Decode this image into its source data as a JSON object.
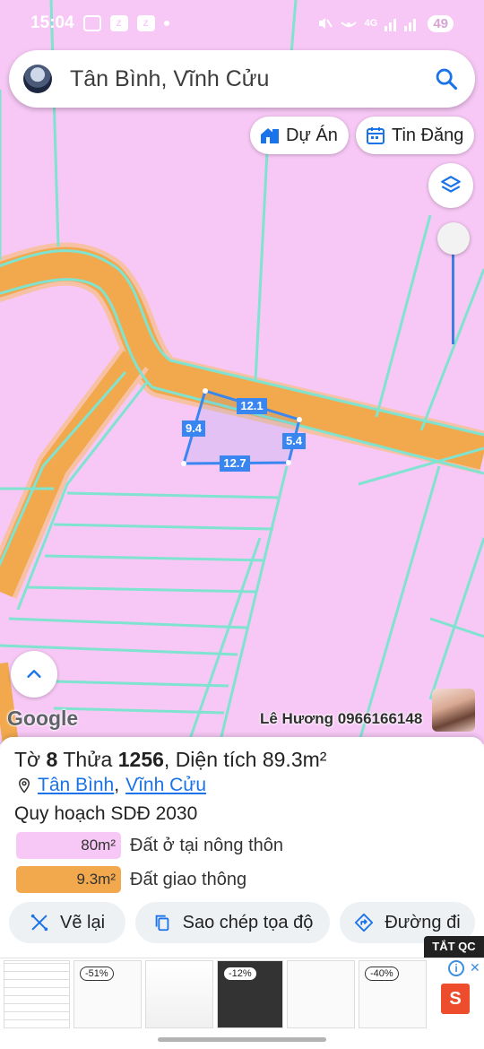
{
  "status_bar": {
    "time": "15:04",
    "battery": "49",
    "network": "4G"
  },
  "search": {
    "text": "Tân Bình, Vĩnh Cửu"
  },
  "chips": {
    "du_an": "Dự Án",
    "tin_dang": "Tin Đăng"
  },
  "map": {
    "dimensions": {
      "top": "12.1",
      "left": "9.4",
      "right": "5.4",
      "bottom": "12.7"
    },
    "google_logo": "Google",
    "contact": "Lê Hương 0966166148",
    "colors": {
      "residential": "#f7c8f5",
      "road": "#f2a84d",
      "boundary": "#7fe3d0",
      "parcel": "#3a86f0"
    }
  },
  "info": {
    "to_label": "Tờ",
    "to": "8",
    "thua_label": "Thửa",
    "thua": "1256",
    "dien_tich_label": "Diện tích",
    "area": "89.3m²",
    "location": {
      "ward": "Tân Bình",
      "separator": ",",
      "district": "Vĩnh Cửu"
    },
    "plan_title": "Quy hoạch SDĐ 2030",
    "legend": [
      {
        "value": "80m²",
        "label": "Đất ở tại nông thôn",
        "color": "#f7c8f5"
      },
      {
        "value": "9.3m²",
        "label": "Đất giao thông",
        "color": "#f2a84d"
      }
    ]
  },
  "actions": {
    "redraw": "Vẽ lại",
    "copy_coords": "Sao chép tọa độ",
    "directions": "Đường đi"
  },
  "ads": {
    "tag": "TẮT QC",
    "badges": [
      "-51%",
      "-12%",
      "-40%"
    ],
    "shop_letter": "S"
  }
}
